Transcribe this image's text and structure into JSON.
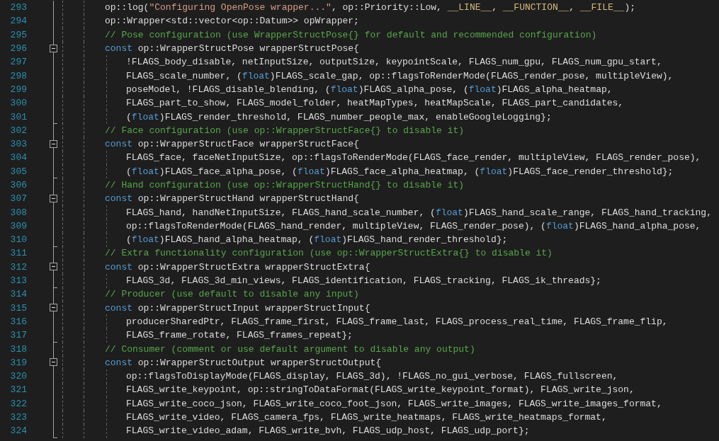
{
  "editor": {
    "lines": [
      {
        "number": "293",
        "tokens": [
          {
            "kind": "plain",
            "text": "op::log("
          },
          {
            "kind": "string",
            "text": "\"Configuring OpenPose wrapper...\""
          },
          {
            "kind": "plain",
            "text": ", op::Priority::Low, "
          },
          {
            "kind": "macro",
            "text": "__LINE__"
          },
          {
            "kind": "plain",
            "text": ", "
          },
          {
            "kind": "macro",
            "text": "__FUNCTION__"
          },
          {
            "kind": "plain",
            "text": ", "
          },
          {
            "kind": "macro",
            "text": "__FILE__"
          },
          {
            "kind": "plain",
            "text": ");"
          }
        ]
      },
      {
        "number": "294",
        "tokens": [
          {
            "kind": "plain",
            "text": "op::Wrapper<std::vector<op::Datum>> opWrapper;"
          }
        ]
      },
      {
        "number": "295",
        "tokens": [
          {
            "kind": "comment",
            "text": "// Pose configuration (use WrapperStructPose{} for default and recommended configuration)"
          }
        ]
      },
      {
        "number": "296",
        "tokens": [
          {
            "kind": "keyword",
            "text": "const"
          },
          {
            "kind": "plain",
            "text": " op::WrapperStructPose wrapperStructPose{"
          }
        ],
        "children": [
          {
            "number": "297",
            "tokens": [
              {
                "kind": "plain",
                "text": "!FLAGS_body_disable, netInputSize, outputSize, keypointScale, FLAGS_num_gpu, FLAGS_num_gpu_start,"
              }
            ]
          },
          {
            "number": "298",
            "tokens": [
              {
                "kind": "plain",
                "text": "FLAGS_scale_number, ("
              },
              {
                "kind": "keyword",
                "text": "float"
              },
              {
                "kind": "plain",
                "text": ")FLAGS_scale_gap, op::flagsToRenderMode(FLAGS_render_pose, multipleView),"
              }
            ]
          },
          {
            "number": "299",
            "tokens": [
              {
                "kind": "plain",
                "text": "poseModel, !FLAGS_disable_blending, ("
              },
              {
                "kind": "keyword",
                "text": "float"
              },
              {
                "kind": "plain",
                "text": ")FLAGS_alpha_pose, ("
              },
              {
                "kind": "keyword",
                "text": "float"
              },
              {
                "kind": "plain",
                "text": ")FLAGS_alpha_heatmap,"
              }
            ]
          },
          {
            "number": "300",
            "tokens": [
              {
                "kind": "plain",
                "text": "FLAGS_part_to_show, FLAGS_model_folder, heatMapTypes, heatMapScale, FLAGS_part_candidates,"
              }
            ]
          },
          {
            "number": "301",
            "tokens": [
              {
                "kind": "plain",
                "text": "("
              },
              {
                "kind": "keyword",
                "text": "float"
              },
              {
                "kind": "plain",
                "text": ")FLAGS_render_threshold, FLAGS_number_people_max, enableGoogleLogging};"
              }
            ]
          }
        ]
      },
      {
        "number": "302",
        "tokens": [
          {
            "kind": "comment",
            "text": "// Face configuration (use op::WrapperStructFace{} to disable it)"
          }
        ]
      },
      {
        "number": "303",
        "tokens": [
          {
            "kind": "keyword",
            "text": "const"
          },
          {
            "kind": "plain",
            "text": " op::WrapperStructFace wrapperStructFace{"
          }
        ],
        "children": [
          {
            "number": "304",
            "tokens": [
              {
                "kind": "plain",
                "text": "FLAGS_face, faceNetInputSize, op::flagsToRenderMode(FLAGS_face_render, multipleView, FLAGS_render_pose),"
              }
            ]
          },
          {
            "number": "305",
            "tokens": [
              {
                "kind": "plain",
                "text": "("
              },
              {
                "kind": "keyword",
                "text": "float"
              },
              {
                "kind": "plain",
                "text": ")FLAGS_face_alpha_pose, ("
              },
              {
                "kind": "keyword",
                "text": "float"
              },
              {
                "kind": "plain",
                "text": ")FLAGS_face_alpha_heatmap, ("
              },
              {
                "kind": "keyword",
                "text": "float"
              },
              {
                "kind": "plain",
                "text": ")FLAGS_face_render_threshold};"
              }
            ]
          }
        ]
      },
      {
        "number": "306",
        "tokens": [
          {
            "kind": "comment",
            "text": "// Hand configuration (use op::WrapperStructHand{} to disable it)"
          }
        ]
      },
      {
        "number": "307",
        "tokens": [
          {
            "kind": "keyword",
            "text": "const"
          },
          {
            "kind": "plain",
            "text": " op::WrapperStructHand wrapperStructHand{"
          }
        ],
        "children": [
          {
            "number": "308",
            "tokens": [
              {
                "kind": "plain",
                "text": "FLAGS_hand, handNetInputSize, FLAGS_hand_scale_number, ("
              },
              {
                "kind": "keyword",
                "text": "float"
              },
              {
                "kind": "plain",
                "text": ")FLAGS_hand_scale_range, FLAGS_hand_tracking,"
              }
            ]
          },
          {
            "number": "309",
            "tokens": [
              {
                "kind": "plain",
                "text": "op::flagsToRenderMode(FLAGS_hand_render, multipleView, FLAGS_render_pose), ("
              },
              {
                "kind": "keyword",
                "text": "float"
              },
              {
                "kind": "plain",
                "text": ")FLAGS_hand_alpha_pose,"
              }
            ]
          },
          {
            "number": "310",
            "tokens": [
              {
                "kind": "plain",
                "text": "("
              },
              {
                "kind": "keyword",
                "text": "float"
              },
              {
                "kind": "plain",
                "text": ")FLAGS_hand_alpha_heatmap, ("
              },
              {
                "kind": "keyword",
                "text": "float"
              },
              {
                "kind": "plain",
                "text": ")FLAGS_hand_render_threshold};"
              }
            ]
          }
        ]
      },
      {
        "number": "311",
        "tokens": [
          {
            "kind": "comment",
            "text": "// Extra functionality configuration (use op::WrapperStructExtra{} to disable it)"
          }
        ]
      },
      {
        "number": "312",
        "tokens": [
          {
            "kind": "keyword",
            "text": "const"
          },
          {
            "kind": "plain",
            "text": " op::WrapperStructExtra wrapperStructExtra{"
          }
        ],
        "children": [
          {
            "number": "313",
            "tokens": [
              {
                "kind": "plain",
                "text": "FLAGS_3d, FLAGS_3d_min_views, FLAGS_identification, FLAGS_tracking, FLAGS_ik_threads};"
              }
            ]
          }
        ]
      },
      {
        "number": "314",
        "tokens": [
          {
            "kind": "comment",
            "text": "// Producer (use default to disable any input)"
          }
        ]
      },
      {
        "number": "315",
        "tokens": [
          {
            "kind": "keyword",
            "text": "const"
          },
          {
            "kind": "plain",
            "text": " op::WrapperStructInput wrapperStructInput{"
          }
        ],
        "children": [
          {
            "number": "316",
            "tokens": [
              {
                "kind": "plain",
                "text": "producerSharedPtr, FLAGS_frame_first, FLAGS_frame_last, FLAGS_process_real_time, FLAGS_frame_flip,"
              }
            ]
          },
          {
            "number": "317",
            "tokens": [
              {
                "kind": "plain",
                "text": "FLAGS_frame_rotate, FLAGS_frames_repeat};"
              }
            ]
          }
        ]
      },
      {
        "number": "318",
        "tokens": [
          {
            "kind": "comment",
            "text": "// Consumer (comment or use default argument to disable any output)"
          }
        ]
      },
      {
        "number": "319",
        "tokens": [
          {
            "kind": "keyword",
            "text": "const"
          },
          {
            "kind": "plain",
            "text": " op::WrapperStructOutput wrapperStructOutput{"
          }
        ],
        "children": [
          {
            "number": "320",
            "tokens": [
              {
                "kind": "plain",
                "text": "op::flagsToDisplayMode(FLAGS_display, FLAGS_3d), !FLAGS_no_gui_verbose, FLAGS_fullscreen,"
              }
            ]
          },
          {
            "number": "321",
            "tokens": [
              {
                "kind": "plain",
                "text": "FLAGS_write_keypoint, op::stringToDataFormat(FLAGS_write_keypoint_format), FLAGS_write_json,"
              }
            ]
          },
          {
            "number": "322",
            "tokens": [
              {
                "kind": "plain",
                "text": "FLAGS_write_coco_json, FLAGS_write_coco_foot_json, FLAGS_write_images, FLAGS_write_images_format,"
              }
            ]
          },
          {
            "number": "323",
            "tokens": [
              {
                "kind": "plain",
                "text": "FLAGS_write_video, FLAGS_camera_fps, FLAGS_write_heatmaps, FLAGS_write_heatmaps_format,"
              }
            ]
          },
          {
            "number": "324",
            "tokens": [
              {
                "kind": "plain",
                "text": "FLAGS_write_video_adam, FLAGS_write_bvh, FLAGS_udp_host, FLAGS_udp_port};"
              }
            ]
          }
        ]
      }
    ]
  }
}
